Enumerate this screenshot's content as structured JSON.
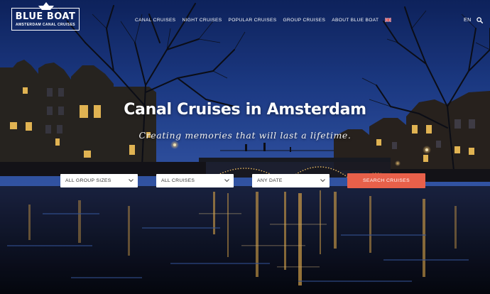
{
  "logo": {
    "brand": "BLUE BOAT",
    "tagline": "AMSTERDAM CANAL CRUISES"
  },
  "nav": {
    "items": [
      "CANAL CRUISES",
      "NIGHT CRUISES",
      "POPULAR CRUISES",
      "GROUP CRUISES",
      "ABOUT BLUE BOAT"
    ],
    "flag_icon": "uk-flag-icon"
  },
  "header": {
    "language": "EN",
    "search_icon": "search-icon"
  },
  "hero": {
    "title": "Canal Cruises in Amsterdam",
    "subtitle": "Creating memories that will last a lifetime."
  },
  "search": {
    "group_size": "ALL GROUP SIZES",
    "cruise_type": "ALL CRUISES",
    "date": "ANY DATE",
    "submit_label": "SEARCH CRUISES"
  },
  "colors": {
    "accent": "#e8604a",
    "sky_top": "#142c6e",
    "water": "#0b1226"
  }
}
